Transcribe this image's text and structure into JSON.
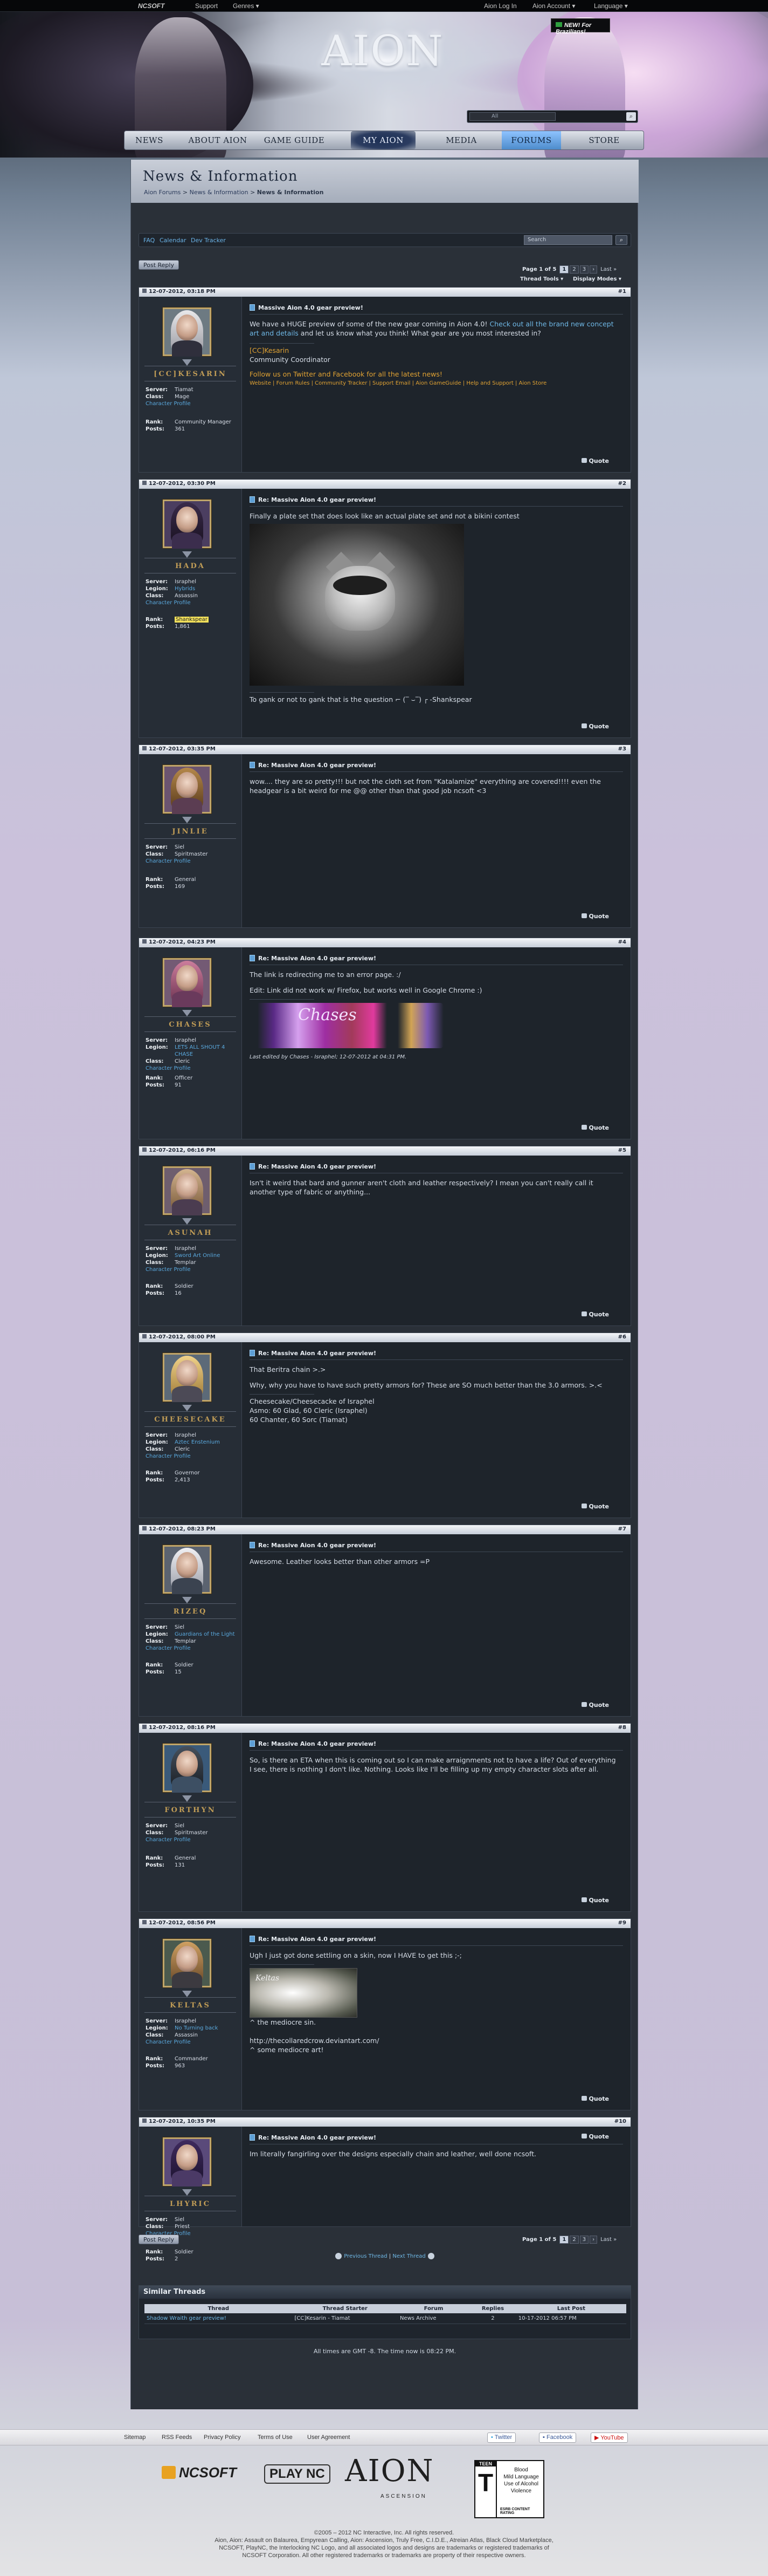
{
  "topbar": {
    "ncsoft": "NCSOFT",
    "support": "Support",
    "games": "Genres ▾",
    "login": "Aion Log In",
    "account": "Aion Account ▾",
    "language": "Language ▾",
    "brasil": "NEW! For Brazilians!"
  },
  "banner": {
    "logo": "AION",
    "search_scope": "All"
  },
  "nav": {
    "items": [
      "NEWS",
      "ABOUT AION",
      "GAME GUIDE",
      "MY AION",
      "MEDIA",
      "FORUMS",
      "STORE"
    ]
  },
  "page": {
    "title": "News & Information",
    "crumbs": [
      "Aion Forums",
      "News & Information",
      "News & Information"
    ]
  },
  "toolbar": {
    "faq": "FAQ",
    "calendar": "Calendar",
    "tracker": "Dev Tracker",
    "search_placeholder": "Search"
  },
  "controls": {
    "post_reply": "Post Reply",
    "page_label": "Page 1 of 5",
    "pages": [
      "1",
      "2",
      "3",
      "4",
      "5"
    ],
    "next": "›",
    "last": "Last »",
    "thread_tools": "Thread Tools ▾",
    "display_modes": "Display Modes ▾",
    "quote": "Quote"
  },
  "labels": {
    "server": "Server:",
    "legion": "Legion:",
    "class": "Class:",
    "rank": "Rank:",
    "posts": "Posts:",
    "profile": "Character Profile"
  },
  "posts": [
    {
      "date": "12-07-2012, 03:18 PM",
      "num": "#1",
      "user": "[CC]KESARIN",
      "server": "Tiamat",
      "legion": "",
      "class": "Mage",
      "rank": "Community Manager",
      "posts": "361",
      "title": "Massive Aion 4.0 gear preview!",
      "body": [
        "We have a HUGE preview of some of the new gear coming in Aion 4.0!",
        "Check out all the brand new concept art and details",
        "and let us know what you think! What gear are you most interested in?"
      ],
      "sig_name": "[CC]Kesarin",
      "sig_role": "Community Coordinator",
      "follow": "Follow us on Twitter and Facebook for all the latest news!",
      "links": "Website | Forum Rules | Community Tracker | Support Email | Aion GameGuide | Help and Support | Aion Store"
    },
    {
      "date": "12-07-2012, 03:30 PM",
      "num": "#2",
      "user": "HADA",
      "server": "Israphel",
      "legion": "Hybrids",
      "class": "Assassin",
      "rank": "Shankspear",
      "posts": "1,861",
      "title": "Re: Massive Aion 4.0 gear preview!",
      "body": [
        "Finally a plate set that does look like an actual plate set and not a bikini contest"
      ],
      "sig": "To gank or not to gank that is the question ⌐ (‾ ⌣‾) ┌ -Shankspear"
    },
    {
      "date": "12-07-2012, 03:35 PM",
      "num": "#3",
      "user": "JINLIE",
      "server": "Siel",
      "legion": "",
      "class": "Spiritmaster",
      "rank": "General",
      "posts": "169",
      "title": "Re: Massive Aion 4.0 gear preview!",
      "body": [
        "wow.... they are so pretty!!! but not the cloth set from \"Katalamize\" everything are covered!!!! even the headgear is a bit weird for me @@ other than that good job ncsoft <3"
      ]
    },
    {
      "date": "12-07-2012, 04:23 PM",
      "num": "#4",
      "user": "CHASES",
      "server": "Israphel",
      "legion": "LETS ALL SHOUT 4 CHASE",
      "class": "Cleric",
      "rank": "Officer",
      "posts": "91",
      "title": "Re: Massive Aion 4.0 gear preview!",
      "body": [
        "The link is redirecting me to an error page. :/",
        "Edit: Link did not work w/ Firefox, but works well in Google Chrome :)"
      ],
      "sig_text": "Chases",
      "edited": "Last edited by Chases - Israphel; 12-07-2012 at 04:31 PM."
    },
    {
      "date": "12-07-2012, 06:16 PM",
      "num": "#5",
      "user": "ASUNAH",
      "server": "Israphel",
      "legion": "Sword Art Online",
      "class": "Templar",
      "rank": "Soldier",
      "posts": "16",
      "title": "Re: Massive Aion 4.0 gear preview!",
      "body": [
        "Isn't it weird that bard and gunner aren't cloth and leather respectively? I mean you can't really call it another type of fabric or anything..."
      ]
    },
    {
      "date": "12-07-2012, 08:00 PM",
      "num": "#6",
      "user": "CHEESECAKE",
      "server": "Israphel",
      "legion": "Aztec Enstenium",
      "class": "Cleric",
      "rank": "Governor",
      "posts": "2,413",
      "title": "Re: Massive Aion 4.0 gear preview!",
      "body": [
        "That Beritra chain >.>",
        "Why, why you have to have such pretty armors for? These are SO much better than the 3.0 armors. >.<"
      ],
      "sig": [
        "Cheesecake/Cheesecacke of Israphel",
        "Asmo: 60 Glad, 60 Cleric (Israphel)",
        "60 Chanter, 60 Sorc (Tiamat)"
      ]
    },
    {
      "date": "12-07-2012, 08:23 PM",
      "num": "#7",
      "user": "RIZEQ",
      "server": "Siel",
      "legion": "Guardians of the Light",
      "class": "Templar",
      "rank": "Soldier",
      "posts": "15",
      "title": "Re: Massive Aion 4.0 gear preview!",
      "body": [
        "Awesome. Leather looks better than other armors =P"
      ]
    },
    {
      "date": "12-07-2012, 08:16 PM",
      "num": "#8",
      "user": "FORTHYN",
      "server": "Siel",
      "legion": "",
      "class": "Spiritmaster",
      "rank": "General",
      "posts": "131",
      "title": "Re: Massive Aion 4.0 gear preview!",
      "body": [
        "So, is there an ETA when this is coming out so I can make arraignments not to have a life? Out of everything I see, there is nothing I don't like. Nothing. Looks like I'll be filling up my empty character slots after all."
      ]
    },
    {
      "date": "12-07-2012, 08:56 PM",
      "num": "#9",
      "user": "KELTAS",
      "server": "Israphel",
      "legion": "No Turning back",
      "class": "Assassin",
      "rank": "Commander",
      "posts": "963",
      "title": "Re: Massive Aion 4.0 gear preview!",
      "body": [
        "Ugh I just got done settling on a skin, now I HAVE to get this ;-;"
      ],
      "sig_img": "Keltas",
      "sig": [
        "^ the mediocre sin.",
        "",
        "http://thecollaredcrow.deviantart.com/",
        "^ some mediocre art!"
      ]
    },
    {
      "date": "12-07-2012, 10:35 PM",
      "num": "#10",
      "user": "LHYRIC",
      "server": "Siel",
      "legion": "",
      "class": "Priest",
      "rank": "Soldier",
      "posts": "2",
      "title": "Re: Massive Aion 4.0 gear preview!",
      "body": [
        "Im literally fangirling over the designs especially chain and leather, well done ncsoft."
      ]
    }
  ],
  "threadnav": {
    "prev": "Previous Thread",
    "next": "Next Thread"
  },
  "similar": {
    "title": "Similar Threads",
    "cols": [
      "Thread",
      "Thread Starter",
      "Forum",
      "Replies",
      "Last Post"
    ],
    "rows": [
      [
        "Shadow Wraith gear preview!",
        "[CC]Kesarin - Tiamat",
        "News Archive",
        "2",
        "10-17-2012 06:57 PM"
      ]
    ]
  },
  "tz": "All times are GMT -8. The time now is 08:22 PM.",
  "footer": {
    "links": [
      "Sitemap",
      "RSS Feeds",
      "Privacy Policy",
      "Terms of Use",
      "User Agreement"
    ],
    "twitter": "Twitter",
    "facebook": "Facebook",
    "youtube": "YouTube",
    "ncsoft": "NCSOFT",
    "plaync": "PLAY NC",
    "aion": "AION",
    "aion_sub": "ASCENSION",
    "esrb_teen": "TEEN",
    "esrb_desc": [
      "Blood",
      "Mild Language",
      "Use of Alcohol",
      "Violence"
    ],
    "esrb_note": "ESRB CONTENT RATING",
    "legal": [
      "©2005 – 2012 NC Interactive, Inc. All rights reserved.",
      "Aion, Aion: Assault on Balaurea, Empyrean Calling, Aion: Ascension, Truly Free, C.I.D.E., Atreian Atlas, Black Cloud Marketplace,",
      "NCSOFT, PlayNC, the Interlocking NC Logo, and all associated logos and designs are trademarks or registered trademarks of",
      "NCSOFT Corporation. All other registered trademarks or trademarks are property of their respective owners."
    ]
  },
  "colors": {
    "accent": "#6fb8e6",
    "username": "#c09c56",
    "panel": "#222930",
    "rank_highlight": "#f4e25b"
  }
}
